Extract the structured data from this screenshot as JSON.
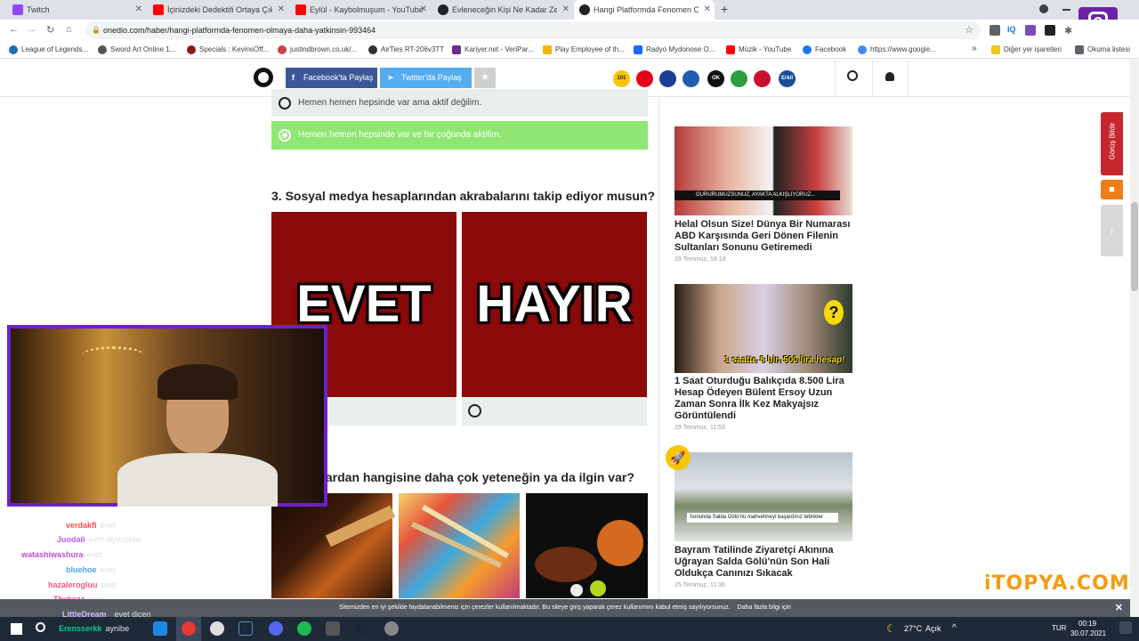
{
  "browser": {
    "tabs": [
      {
        "title": "Twitch",
        "color": "#9146ff"
      },
      {
        "title": "İçinizdeki Dedektifi Ortaya Çıkaracak",
        "color": "#ff0000"
      },
      {
        "title": "Eylül - Kaybolmuşum - YouTube",
        "color": "#ff0000"
      },
      {
        "title": "Evleneceğin Kişi Ne Kadar Zengin",
        "color": "#222222"
      },
      {
        "title": "Hangi Platformda Fenomen Olma",
        "color": "#222222"
      }
    ],
    "new_tab": "+",
    "url": "onedio.com/haber/hangi-platformda-fenomen-olmaya-daha-yatkinsin-993464",
    "bookmarks": [
      "League of Legends...",
      "Sword Art Online 1...",
      "Specials : KevinsOff...",
      "justindbrown.co.uk/...",
      "AirTies RT-206v3TT",
      "Kariyer.net - VeriPar...",
      "Play Employee of th...",
      "Radyo Mydonose O...",
      "Müzik - YouTube",
      "Facebook",
      "https://www.google..."
    ],
    "bookmarks_right": [
      "Diğer yer işaretleri",
      "Okuma listesi"
    ],
    "overflow": "»"
  },
  "site": {
    "share_facebook": "Facebook'ta Paylaş",
    "share_twitter": "Twitter'da Paylaş",
    "badges": [
      "101",
      "",
      "",
      "",
      "OK",
      "",
      "",
      "Erkil"
    ]
  },
  "quiz": {
    "prev_options": [
      "Hemen hemen hepsinde var ama aktif değilim.",
      "Hemen hemen hepsinde var ve bir çoğunda aktifim."
    ],
    "q3": "3. Sosyal medya hesaplarından akrabalarını takip ediyor musun?",
    "yes": "EVET",
    "no": "HAYIR",
    "q4": "lardan hangisine daha çok yeteneğin ya da ilgin var?"
  },
  "sidebar": {
    "articles": [
      {
        "caption": "GURURUMUZSUNUZ, AYAKTA ALKIŞLIYORUZ...",
        "title": "Helal Olsun Size! Dünya Bir Numarası ABD Karşısında Geri Dönen Filenin Sultanları Sonunu Getiremedi",
        "date": "29 Temmuz, 18:18"
      },
      {
        "caption": "1 saatte 8 bin 500 lira hesap!",
        "title": "1 Saat Oturduğu Balıkçıda 8.500 Lira Hesap Ödeyen Bülent Ersoy Uzun Zaman Sonra İlk Kez Makyajsız Görüntülendi",
        "date": "29 Temmuz, 11:53"
      },
      {
        "caption": "Sonunda Salda Gölü'nü mahvetmeyi başardınız tebrikler",
        "title": "Bayram Tatilinde Ziyaretçi Akınına Uğrayan Salda Gölü'nün Son Hali Oldukça Canınızı Sıkacak",
        "date": "25 Temmuz, 11:36"
      }
    ],
    "feedback": "Görüş Bildir"
  },
  "chat": [
    {
      "user": "verdakfl",
      "msg": "evet",
      "color": "#ff4d4d"
    },
    {
      "user": "Juodali",
      "msg": "evet diyecektin",
      "color": "#b85cff"
    },
    {
      "user": "watashiwashura",
      "msg": "evet",
      "color": "#c34bd6"
    },
    {
      "user": "bluehoe",
      "msg": "evet",
      "color": "#4d9fff"
    },
    {
      "user": "hazalerogluu",
      "msg": "evet",
      "color": "#ff5577"
    },
    {
      "user": "Thykezz",
      "msg": "evet",
      "color": "#ff4da6"
    },
    {
      "user": "LittleDream_",
      "msg": "evet dicen",
      "color": "#d2b4ff"
    },
    {
      "user": "Erensserkk",
      "msg": "aynibe",
      "color": "#00cc88"
    }
  ],
  "watermark": "iTOPYA.COM",
  "cookie": {
    "text": "Sitemizden en iyi şekilde faydalanabilmeniz için çerezler kullanılmaktadır. Bu siteye giriş yaparak çerez kullanımını kabul etmiş sayılıyorsunuz.",
    "link": "Daha fazla bilgi için",
    "close": "✕"
  },
  "taskbar": {
    "weather": "27°C",
    "weather_desc": "Açık",
    "lang": "TUR",
    "time": "00:19",
    "date": "30.07.2021"
  }
}
